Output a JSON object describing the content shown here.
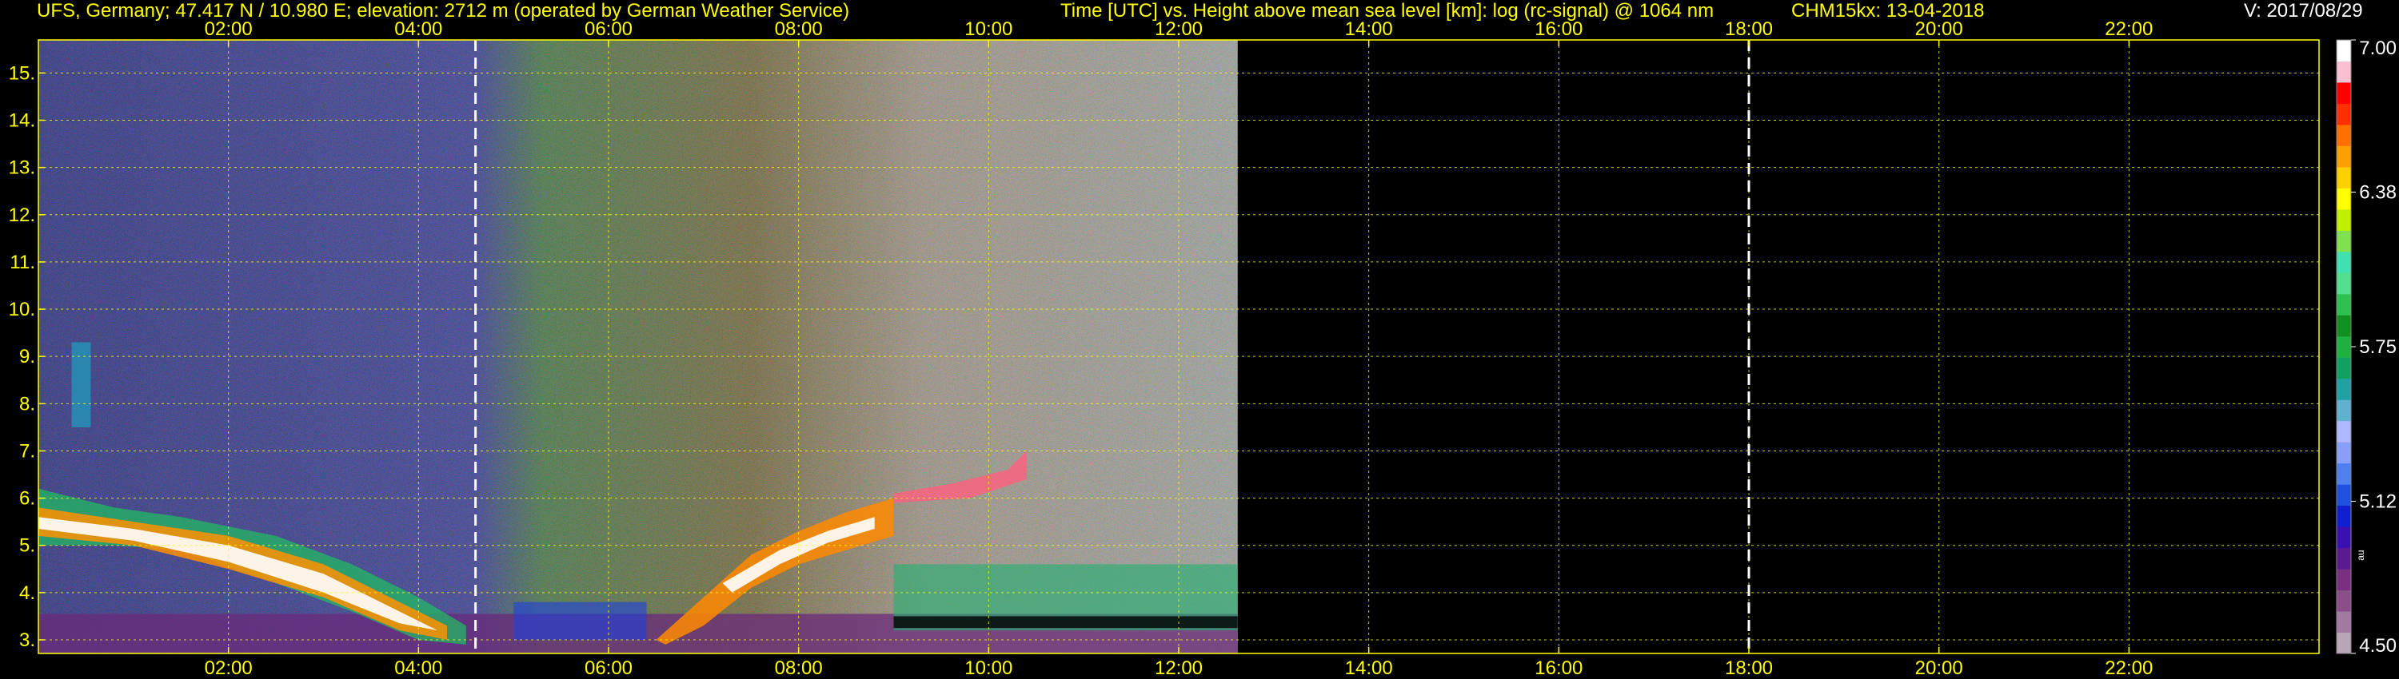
{
  "header": {
    "station": "UFS, Germany; 47.417 N / 10.980 E; elevation: 2712 m  (operated by German Weather Service)",
    "axes_desc": "Time [UTC] vs. Height above mean sea level [km]: log (rc-signal) @ 1064 nm",
    "instrument_date": "CHM15kx: 13-04-2018",
    "version": "V: 2017/08/29"
  },
  "chart_data": {
    "type": "heatmap",
    "title": "Time [UTC] vs. Height above mean sea level [km]: log (rc-signal) @ 1064 nm",
    "xlabel": "Time [UTC]",
    "ylabel": "Height above mean sea level [km]",
    "xlim": [
      0,
      24
    ],
    "ylim": [
      2.712,
      15.7
    ],
    "x_ticks": [
      "02:00",
      "04:00",
      "06:00",
      "08:00",
      "10:00",
      "12:00",
      "14:00",
      "16:00",
      "18:00",
      "20:00",
      "22:00"
    ],
    "x_tick_values": [
      2,
      4,
      6,
      8,
      10,
      12,
      14,
      16,
      18,
      20,
      22
    ],
    "y_ticks": [
      "3.",
      "4.",
      "5.",
      "6.",
      "7.",
      "8.",
      "9.",
      "10.",
      "11.",
      "12.",
      "13.",
      "14.",
      "15."
    ],
    "y_tick_values": [
      3,
      4,
      5,
      6,
      7,
      8,
      9,
      10,
      11,
      12,
      13,
      14,
      15
    ],
    "grid": true,
    "data_end_time": 12.62,
    "markers": [
      {
        "time": 4.6,
        "style": "white dashed line"
      },
      {
        "time": 18.0,
        "style": "white dashed line"
      }
    ],
    "colorbar": {
      "ticks": [
        4.5,
        5.12,
        5.75,
        6.38,
        7.0
      ],
      "tick_labels": [
        "4.50",
        "5.12",
        "5.75",
        "6.38",
        "7.00"
      ],
      "unit_label": "au",
      "colors": [
        "#b9a7b9",
        "#a07aa0",
        "#8a4f8a",
        "#7a2f80",
        "#5a1a90",
        "#3a10b0",
        "#1020d0",
        "#2050e0",
        "#5080f0",
        "#8aa0f8",
        "#b0b8ff",
        "#60b0d0",
        "#20a0a0",
        "#10a060",
        "#20b040",
        "#109020",
        "#30c050",
        "#50e090",
        "#40e0b0",
        "#80e050",
        "#c0f000",
        "#ffff00",
        "#ffd000",
        "#ffa000",
        "#ff7000",
        "#ff3000",
        "#ff0000",
        "#f8c0d0",
        "#ffffff"
      ]
    },
    "observations": [
      {
        "period": "00:00-04:30",
        "feature": "elevated aerosol/cloud layer descending",
        "top_height_km": [
          6.2,
          3.2
        ],
        "base_height_km": [
          5.0,
          2.8
        ]
      },
      {
        "period": "00:30-01:00",
        "feature": "thin elevated filaments",
        "height_km": [
          7.5,
          9.3
        ]
      },
      {
        "period": "06:30-09:00",
        "feature": "rising aerosol/cloud layer",
        "top_height_km": [
          3.0,
          6.0
        ]
      },
      {
        "period": "09:00-12:30",
        "feature": "boundary layer with elevated layer near 6-7 km",
        "height_km": [
          3.0,
          7.1
        ]
      }
    ]
  }
}
